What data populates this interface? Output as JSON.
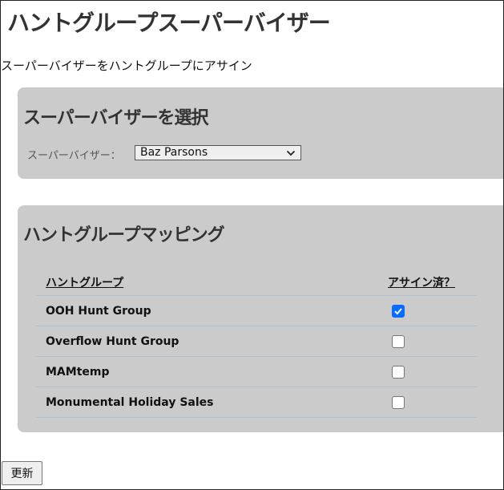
{
  "page": {
    "title": "ハントグループスーパーバイザー",
    "subtitle": "スーパーバイザーをハントグループにアサイン"
  },
  "supervisor_panel": {
    "heading": "スーパーバイザーを選択",
    "label": "スーパーバイザー：",
    "selected": "Baz Parsons"
  },
  "mapping_panel": {
    "heading": "ハントグループマッピング",
    "columns": {
      "group": "ハントグループ",
      "assigned": "アサイン済？"
    },
    "rows": [
      {
        "name": "OOH Hunt Group",
        "assigned": true
      },
      {
        "name": "Overflow Hunt Group",
        "assigned": false
      },
      {
        "name": "MAMtemp",
        "assigned": false
      },
      {
        "name": "Monumental Holiday Sales",
        "assigned": false
      }
    ]
  },
  "actions": {
    "update_label": "更新"
  },
  "colors": {
    "panel_bg": "#cbcbcb",
    "checkbox_checked": "#0a6cff",
    "row_border": "#a8c3d6"
  }
}
